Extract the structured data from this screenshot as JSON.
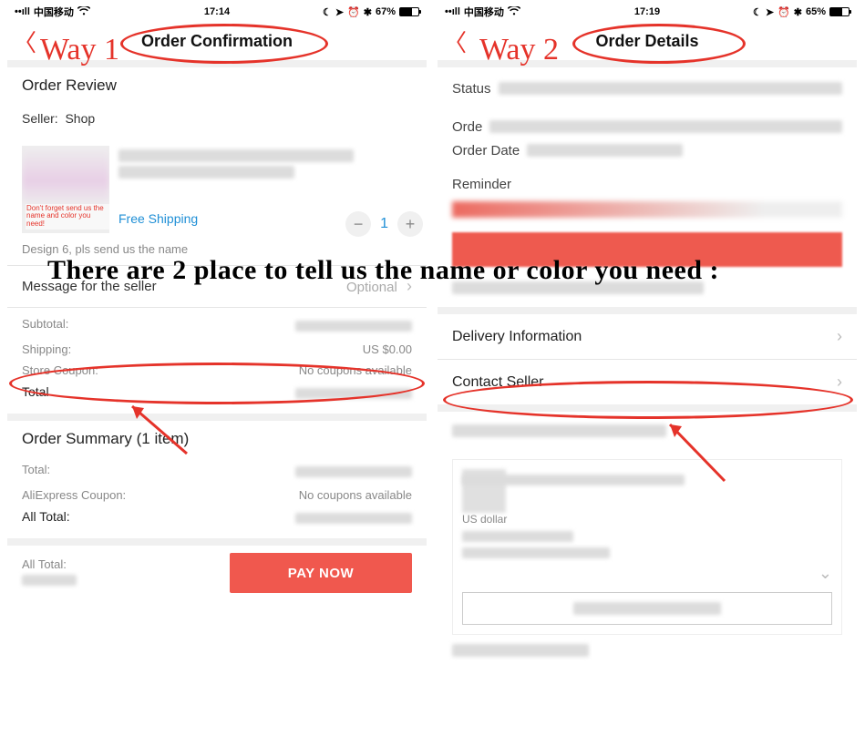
{
  "annotations": {
    "way1": "Way 1",
    "way2": "Way 2",
    "headline": "There are 2 place to tell us the name or color you need :"
  },
  "left": {
    "statusbar": {
      "carrier": "中国移动",
      "time": "17:14",
      "battery": "67%"
    },
    "nav": {
      "title": "Order Confirmation"
    },
    "review_heading": "Order Review",
    "seller_label": "Seller:",
    "seller_name": "Shop",
    "thumb_note_1": "Don't forget send us the",
    "thumb_note_2": "name and color you need!",
    "free_shipping": "Free Shipping",
    "quantity": "1",
    "variant_note": "Design 6, pls send us the name",
    "message_label": "Message for the seller",
    "message_hint": "Optional",
    "subtotal_k": "Subtotal:",
    "shipping_k": "Shipping:",
    "shipping_v": "US $0.00",
    "coupon_k": "Store Coupon:",
    "coupon_v": "No coupons available",
    "total_k": "Total",
    "summary_heading": "Order Summary (1 item)",
    "s_total_k": "Total:",
    "s_ali_k": "AliExpress Coupon:",
    "s_ali_v": "No coupons available",
    "s_all_k": "All Total:",
    "bar_all_k": "All Total:",
    "pay_label": "PAY NOW"
  },
  "right": {
    "statusbar": {
      "carrier": "中国移动",
      "time": "17:19",
      "battery": "65%"
    },
    "nav": {
      "title": "Order Details"
    },
    "status_k": "Status",
    "order_k": "Orde",
    "orderdate_k": "Order Date",
    "reminder_k": "Reminder",
    "delivery": "Delivery Information",
    "contact": "Contact Seller",
    "usd": "US dollar"
  }
}
